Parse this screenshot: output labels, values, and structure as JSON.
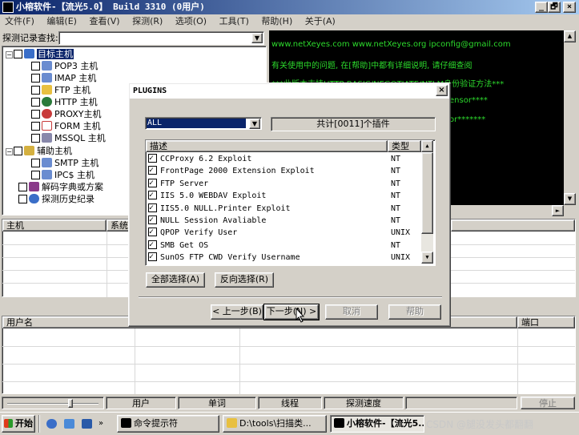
{
  "window": {
    "title": "小榕软件-【流光5.0】 Build 3310 (0用户)",
    "buttons": [
      "_",
      "🗗",
      "×"
    ]
  },
  "menu": [
    "文件(F)",
    "编辑(E)",
    "查看(V)",
    "探测(R)",
    "选项(O)",
    "工具(T)",
    "帮助(H)",
    "关于(A)"
  ],
  "probe": {
    "label": "探测记录查找:",
    "value": ""
  },
  "tree": {
    "target": "目标主机",
    "target_children": [
      "POP3 主机",
      "IMAP 主机",
      "FTP 主机",
      "HTTP 主机",
      "PROXY主机",
      "FORM 主机",
      "MSSQL 主机"
    ],
    "aux": "辅助主机",
    "aux_children": [
      "SMTP 主机",
      "IPC$ 主机"
    ],
    "dict": "解码字典或方案",
    "history": "探测历史纪录"
  },
  "console": {
    "lines": [
      "www.netXeyes.com www.netXeyes.org ipconfig@gmail.com",
      "有关使用中的问题, 在[帮助]中都有详细说明, 请仔细查阅",
      "***此版本支持HTTP BASIC/NEGOTIATE/NTLM身份验证方法***",
      "ensor****",
      "or*******"
    ]
  },
  "host_grid": {
    "columns": [
      "主机",
      "系统"
    ]
  },
  "user_grid": {
    "columns": [
      "用户名",
      "端口"
    ]
  },
  "statusbar": {
    "cells": [
      "用户",
      "单词",
      "线程",
      "探测速度"
    ],
    "stop": "停止"
  },
  "taskbar": {
    "start": "开始",
    "tasks": [
      "命令提示符",
      "D:\\tools\\扫描类...",
      "小榕软件-【流光5..."
    ],
    "watermark": "CSDN @腿没发头都翻翻"
  },
  "dialog": {
    "title": "PLUGINS",
    "filter": "ALL",
    "count": "共计[0011]个插件",
    "columns": [
      "描述",
      "类型"
    ],
    "plugins": [
      {
        "name": "CCProxy 6.2 Exploit",
        "type": "NT"
      },
      {
        "name": "FrontPage 2000 Extension Exploit",
        "type": "NT"
      },
      {
        "name": "FTP Server",
        "type": "NT"
      },
      {
        "name": "IIS 5.0 WEBDAV Exploit",
        "type": "NT"
      },
      {
        "name": "IIS5.0 NULL.Printer Exploit",
        "type": "NT"
      },
      {
        "name": "NULL Session Avaliable",
        "type": "NT"
      },
      {
        "name": "QPOP Verify User",
        "type": "UNIX"
      },
      {
        "name": "SMB Get OS",
        "type": "NT"
      },
      {
        "name": "SunOS FTP CWD Verify Username",
        "type": "UNIX"
      }
    ],
    "select_all": "全部选择(A)",
    "invert": "反向选择(R)",
    "prev": "< 上一步(B)",
    "next": "下一步(N) >",
    "cancel": "取消",
    "help": "帮助"
  }
}
